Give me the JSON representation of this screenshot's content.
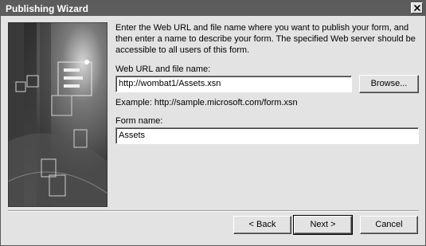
{
  "window": {
    "title": "Publishing Wizard"
  },
  "icons": {
    "close": "close-icon",
    "illustration": "wizard-illustration"
  },
  "main": {
    "instructions": "Enter the Web URL and file name where you want to publish your form, and then enter a name to describe your form. The specified Web server should be accessible to all users of this form.",
    "url_label": "Web URL and file name:",
    "url_value": "http://wombat1/Assets.xsn",
    "browse_label": "Browse...",
    "example_text": "Example: http://sample.microsoft.com/form.xsn",
    "form_name_label": "Form name:",
    "form_name_value": "Assets"
  },
  "footer": {
    "back_label": "< Back",
    "next_label": "Next >",
    "cancel_label": "Cancel"
  }
}
